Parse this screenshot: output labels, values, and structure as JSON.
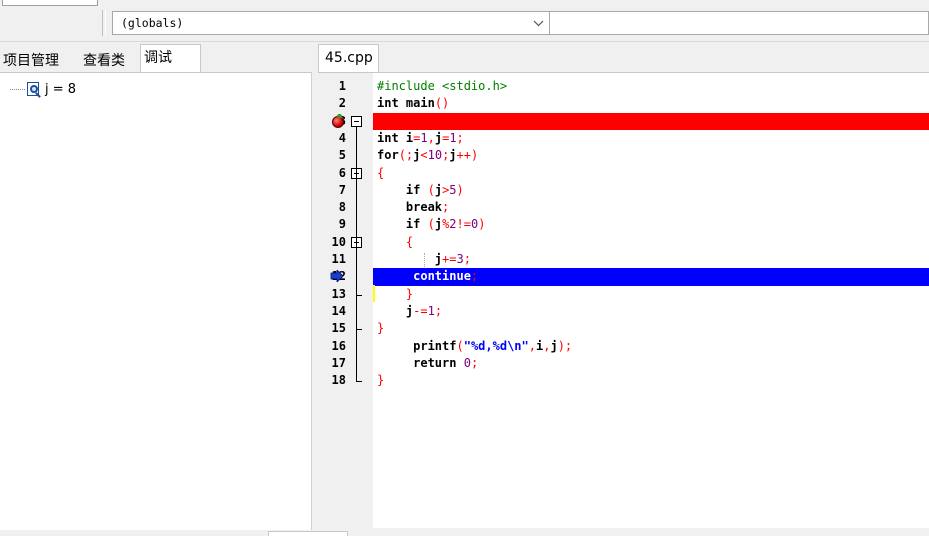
{
  "toolbar": {
    "scope_combo_value": "(globals)",
    "combo_arrow_icon": "chevron-down-icon"
  },
  "left_panel": {
    "tabs": [
      "项目管理",
      "查看类",
      "调试"
    ],
    "active_tab": "调试",
    "watch_items": [
      {
        "icon": "watch-variable-icon",
        "text": "j = 8"
      }
    ]
  },
  "editor": {
    "file_tab": "45.cpp",
    "breakpoint_line": 3,
    "current_exec_line": 12,
    "lines": [
      {
        "n": "1",
        "tokens": [
          [
            "pp",
            "#include <stdio.h>"
          ]
        ]
      },
      {
        "n": "2",
        "tokens": [
          [
            "kw",
            "int"
          ],
          [
            "id",
            " main"
          ],
          [
            "sym",
            "()"
          ]
        ]
      },
      {
        "n": "3",
        "tokens": [
          [
            "sym",
            "{"
          ]
        ]
      },
      {
        "n": "4",
        "tokens": [
          [
            "kw",
            "int"
          ],
          [
            "id",
            " i"
          ],
          [
            "sym",
            "="
          ],
          [
            "num",
            "1"
          ],
          [
            "sym",
            ","
          ],
          [
            "id",
            "j"
          ],
          [
            "sym",
            "="
          ],
          [
            "num",
            "1"
          ],
          [
            "sym",
            ";"
          ]
        ]
      },
      {
        "n": "5",
        "tokens": [
          [
            "kw",
            "for"
          ],
          [
            "sym",
            "(;"
          ],
          [
            "id",
            "j"
          ],
          [
            "sym",
            "<"
          ],
          [
            "num",
            "10"
          ],
          [
            "sym",
            ";"
          ],
          [
            "id",
            "j"
          ],
          [
            "sym",
            "++)"
          ]
        ]
      },
      {
        "n": "6",
        "tokens": [
          [
            "sym",
            "{"
          ]
        ]
      },
      {
        "n": "7",
        "tokens": [
          [
            "id",
            "    "
          ],
          [
            "kw",
            "if"
          ],
          [
            "id",
            " "
          ],
          [
            "sym",
            "("
          ],
          [
            "id",
            "j"
          ],
          [
            "sym",
            ">"
          ],
          [
            "num",
            "5"
          ],
          [
            "sym",
            ")"
          ]
        ]
      },
      {
        "n": "8",
        "tokens": [
          [
            "id",
            "    "
          ],
          [
            "kw",
            "break"
          ],
          [
            "sym",
            ";"
          ]
        ]
      },
      {
        "n": "9",
        "tokens": [
          [
            "id",
            "    "
          ],
          [
            "kw",
            "if"
          ],
          [
            "id",
            " "
          ],
          [
            "sym",
            "("
          ],
          [
            "id",
            "j"
          ],
          [
            "sym",
            "%"
          ],
          [
            "num",
            "2"
          ],
          [
            "sym",
            "!="
          ],
          [
            "num",
            "0"
          ],
          [
            "sym",
            ")"
          ]
        ]
      },
      {
        "n": "10",
        "tokens": [
          [
            "id",
            "    "
          ],
          [
            "sym",
            "{"
          ]
        ]
      },
      {
        "n": "11",
        "tokens": [
          [
            "id",
            "        "
          ],
          [
            "id",
            "j"
          ],
          [
            "sym",
            "+="
          ],
          [
            "num",
            "3"
          ],
          [
            "sym",
            ";"
          ]
        ]
      },
      {
        "n": "12",
        "tokens": [
          [
            "id",
            "     "
          ],
          [
            "kw",
            "continue"
          ],
          [
            "sym",
            ";"
          ]
        ]
      },
      {
        "n": "13",
        "tokens": [
          [
            "id",
            "    "
          ],
          [
            "sym",
            "}"
          ]
        ]
      },
      {
        "n": "14",
        "tokens": [
          [
            "id",
            "    "
          ],
          [
            "id",
            "j"
          ],
          [
            "sym",
            "-="
          ],
          [
            "num",
            "1"
          ],
          [
            "sym",
            ";"
          ]
        ]
      },
      {
        "n": "15",
        "tokens": [
          [
            "sym",
            "}"
          ]
        ]
      },
      {
        "n": "16",
        "tokens": [
          [
            "id",
            "     printf"
          ],
          [
            "sym",
            "("
          ],
          [
            "str",
            "\"%d,%d\\n\""
          ],
          [
            "sym",
            ","
          ],
          [
            "id",
            "i"
          ],
          [
            "sym",
            ","
          ],
          [
            "id",
            "j"
          ],
          [
            "sym",
            ");"
          ]
        ]
      },
      {
        "n": "17",
        "tokens": [
          [
            "id",
            "     "
          ],
          [
            "kw",
            "return"
          ],
          [
            "id",
            " "
          ],
          [
            "num",
            "0"
          ],
          [
            "sym",
            ";"
          ]
        ]
      },
      {
        "n": "18",
        "tokens": [
          [
            "sym",
            "}"
          ]
        ]
      }
    ]
  }
}
